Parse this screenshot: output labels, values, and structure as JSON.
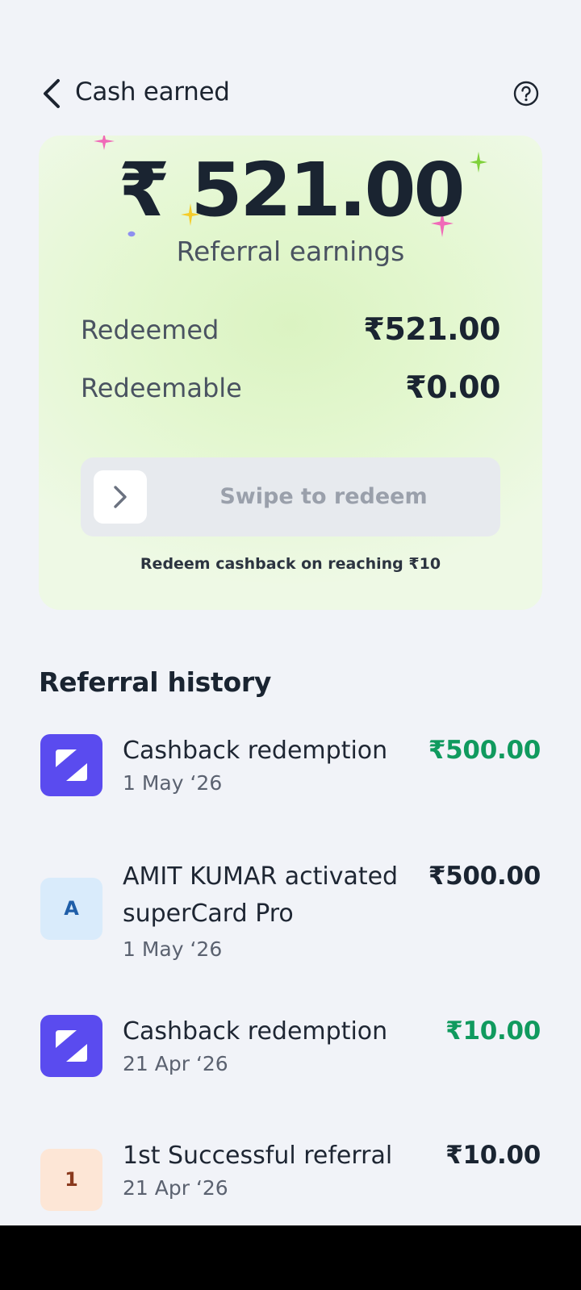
{
  "header": {
    "title": "Cash earned"
  },
  "earnings": {
    "amount": "₹ 521.00",
    "label": "Referral earnings",
    "rows": [
      {
        "label": "Redeemed",
        "value": "₹521.00"
      },
      {
        "label": "Redeemable",
        "value": "₹0.00"
      }
    ],
    "swipe_label": "Swipe to redeem",
    "hint": "Redeem cashback on reaching ₹10"
  },
  "history": {
    "title": "Referral history",
    "items": [
      {
        "title": "Cashback redemption",
        "date": "1 May ‘26",
        "amount": "₹500.00",
        "icon": "brand-logo-icon",
        "amount_color": "#109a5e"
      },
      {
        "title": "AMIT KUMAR activated superCard Pro",
        "date": "1 May ‘26",
        "amount": "₹500.00",
        "icon_letter": "A",
        "amount_color": "#1a2431"
      },
      {
        "title": "Cashback redemption",
        "date": "21 Apr ‘26",
        "amount": "₹10.00",
        "icon": "brand-logo-icon",
        "amount_color": "#109a5e"
      },
      {
        "title": "1st Successful referral",
        "date": "21 Apr ‘26",
        "amount": "₹10.00",
        "icon_letter": "1",
        "amount_color": "#1a2431"
      }
    ]
  },
  "colors": {
    "accent_brand": "#5a4bef",
    "credit_green": "#109a5e",
    "card_green": "#dbf3c2"
  }
}
